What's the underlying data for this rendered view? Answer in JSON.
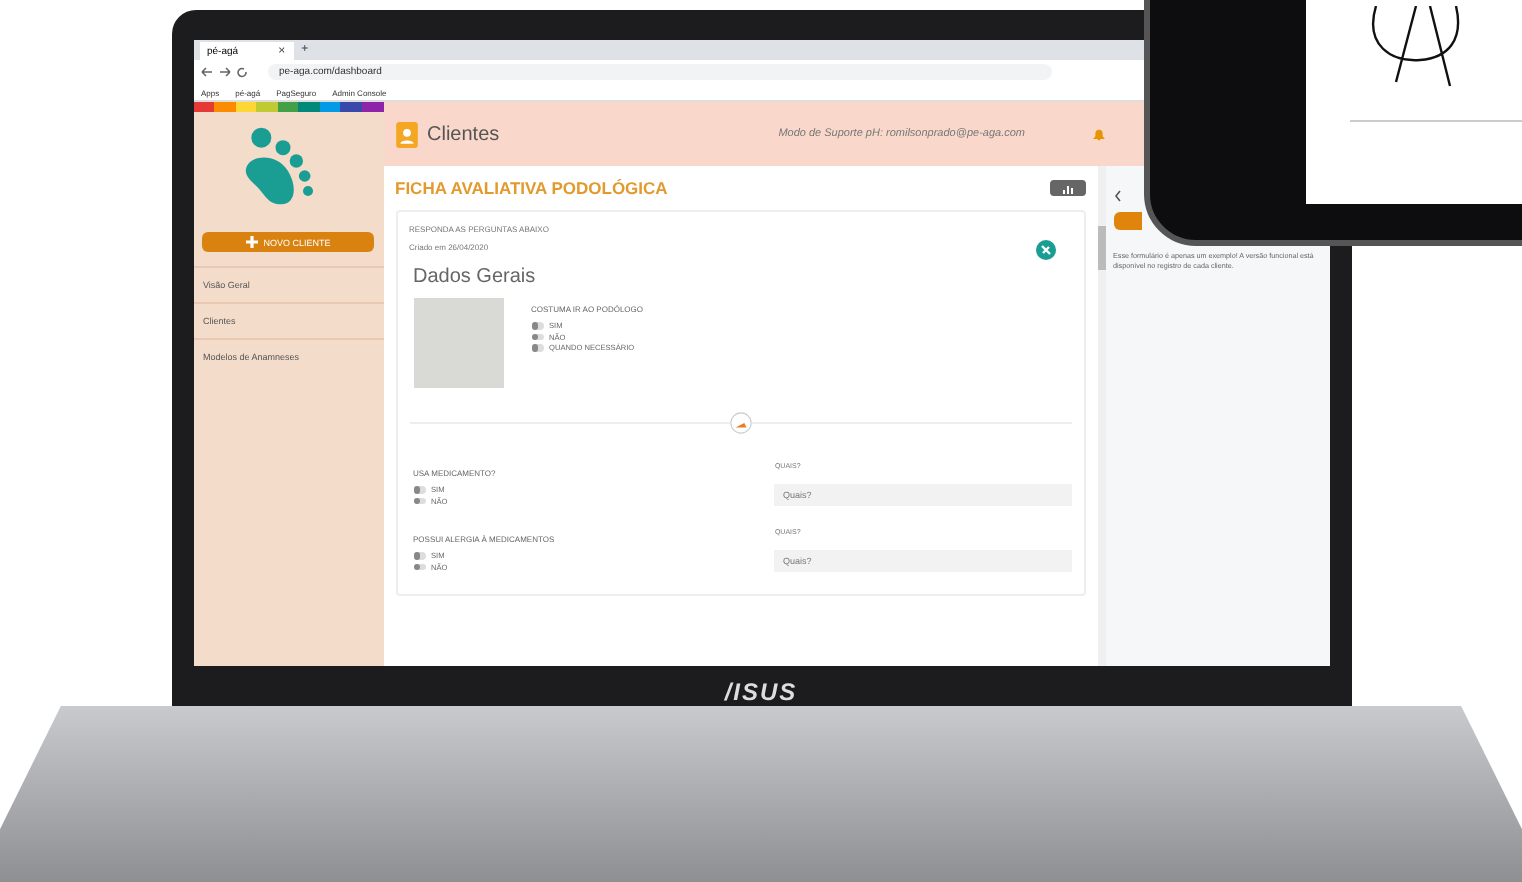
{
  "browser": {
    "tab_title": "pé-agá",
    "tab_close": "×",
    "new_tab": "+",
    "url": "pe-aga.com/dashboard",
    "bookmarks": [
      "Apps",
      "pé-agá",
      "PagSeguro",
      "Admin Console"
    ]
  },
  "sidebar": {
    "button": "NOVO CLIENTE",
    "items": [
      {
        "label": "Visão Geral",
        "selected": false
      },
      {
        "label": "Clientes",
        "selected": false
      },
      {
        "label": "Modelos de Anamneses",
        "selected": false
      }
    ]
  },
  "header": {
    "title": "Clientes",
    "support": "Modo de Suporte pH: romilsonprado@pe-aga.com"
  },
  "page_title": "FICHA AVALIATIVA PODOLÓGICA",
  "form": {
    "instruction": "RESPONDA AS PERGUNTAS ABAIXO",
    "created": "Criado em 26/04/2020",
    "section": "Dados Gerais",
    "first_question": {
      "label": "COSTUMA IR AO PODÓLOGO",
      "options": [
        {
          "label": "SIM",
          "selected": false
        },
        {
          "label": "NÃO",
          "selected": false
        },
        {
          "label": "QUANDO NECESSÁRIO",
          "selected": false
        }
      ]
    },
    "questions": [
      {
        "label": "USA MEDICAMENTO?",
        "options": [
          {
            "label": "SIM",
            "selected": false
          },
          {
            "label": "NÃO",
            "selected": false
          }
        ],
        "field_label": "QUAIS?",
        "placeholder": "Quais?"
      },
      {
        "label": "POSSUI ALERGIA À MEDICAMENTOS",
        "options": [
          {
            "label": "SIM",
            "selected": false
          },
          {
            "label": "NÃO",
            "selected": false
          }
        ],
        "field_label": "QUAIS?",
        "placeholder": "Quais?"
      }
    ]
  },
  "side_panel": {
    "note": "Esse formulário é apenas um exemplo! A versão funcional está disponível no registro de cada cliente."
  },
  "bezel_logo": "/ISUS"
}
